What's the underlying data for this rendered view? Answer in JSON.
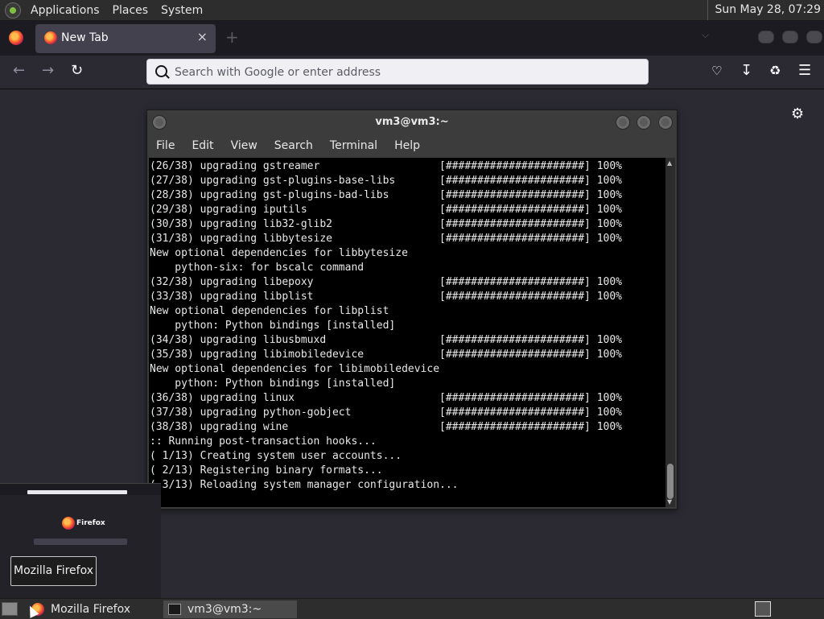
{
  "top_panel": {
    "menus": [
      "Applications",
      "Places",
      "System"
    ],
    "clock": "Sun May 28, 07:29"
  },
  "browser": {
    "tab_title": "New Tab",
    "tab_close": "×",
    "new_tab_symbol": "+",
    "url_placeholder": "Search with Google or enter address",
    "icons": [
      "firefox-view-icon",
      "back-icon",
      "forward-icon",
      "reload-icon",
      "pocket-icon",
      "downloads-icon",
      "extensions-icon",
      "menu-icon",
      "settings-icon"
    ]
  },
  "terminal": {
    "title": "vm3@vm3:~",
    "menus": [
      "File",
      "Edit",
      "View",
      "Search",
      "Terminal",
      "Help"
    ],
    "lines": [
      "(26/38) upgrading gstreamer                   [######################] 100%",
      "(27/38) upgrading gst-plugins-base-libs       [######################] 100%",
      "(28/38) upgrading gst-plugins-bad-libs        [######################] 100%",
      "(29/38) upgrading iputils                     [######################] 100%",
      "(30/38) upgrading lib32-glib2                 [######################] 100%",
      "(31/38) upgrading libbytesize                 [######################] 100%",
      "New optional dependencies for libbytesize",
      "    python-six: for bscalc command",
      "(32/38) upgrading libepoxy                    [######################] 100%",
      "(33/38) upgrading libplist                    [######################] 100%",
      "New optional dependencies for libplist",
      "    python: Python bindings [installed]",
      "(34/38) upgrading libusbmuxd                  [######################] 100%",
      "(35/38) upgrading libimobiledevice            [######################] 100%",
      "New optional dependencies for libimobiledevice",
      "    python: Python bindings [installed]",
      "(36/38) upgrading linux                       [######################] 100%",
      "(37/38) upgrading python-gobject              [######################] 100%",
      "(38/38) upgrading wine                        [######################] 100%",
      ":: Running post-transaction hooks...",
      "( 1/13) Creating system user accounts...",
      "( 2/13) Registering binary formats...",
      "( 3/13) Reloading system manager configuration..."
    ]
  },
  "preview": {
    "logo_text": "Firefox"
  },
  "tooltip": "Mozilla Firefox",
  "taskbar": {
    "items": [
      "Mozilla Firefox",
      "vm3@vm3:~"
    ]
  }
}
